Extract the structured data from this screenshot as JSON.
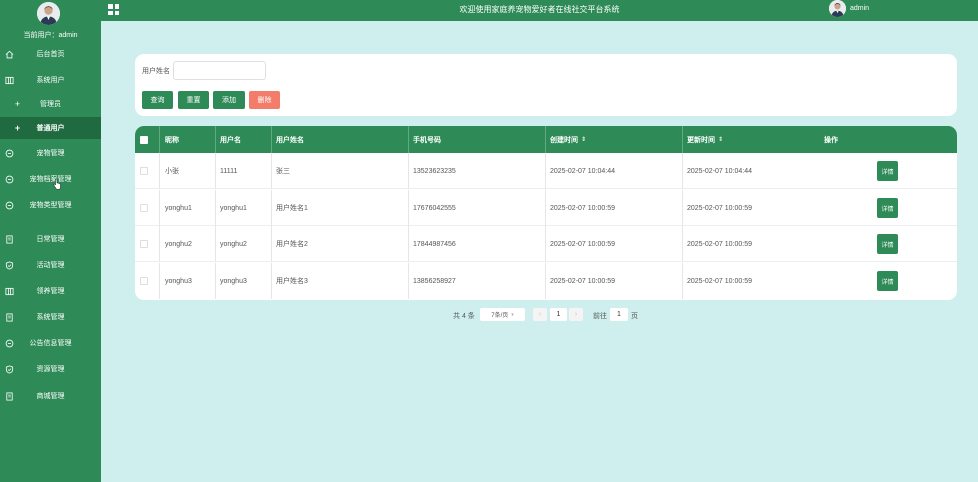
{
  "sidebar": {
    "current_user": "当前用户：admin",
    "items": [
      {
        "label": "后台首页",
        "icon": "home-icon"
      },
      {
        "label": "系统用户",
        "icon": "columns-icon"
      },
      {
        "label": "管理员",
        "icon": "plus-icon"
      },
      {
        "label": "普通用户",
        "icon": "plus-icon"
      },
      {
        "label": "宠物管理",
        "icon": "chat-icon"
      },
      {
        "label": "宠物档案管理",
        "icon": "chat-icon"
      },
      {
        "label": "宠物类型管理",
        "icon": "chat-icon"
      },
      {
        "label": "日常管理",
        "icon": "document-icon"
      },
      {
        "label": "活动管理",
        "icon": "shield-icon"
      },
      {
        "label": "领养管理",
        "icon": "columns-icon"
      },
      {
        "label": "系统管理",
        "icon": "document-icon"
      },
      {
        "label": "公告信息管理",
        "icon": "chat-icon"
      },
      {
        "label": "资源管理",
        "icon": "shield-icon"
      },
      {
        "label": "商城管理",
        "icon": "document-icon"
      }
    ]
  },
  "topbar": {
    "title": "欢迎使用家庭养宠物爱好者在线社交平台系统",
    "username": "admin"
  },
  "search": {
    "label": "用户姓名",
    "value": "",
    "buttons": {
      "query": "查询",
      "reset": "重置",
      "add": "添加",
      "delete": "删除"
    }
  },
  "table": {
    "headers": [
      "昵称",
      "用户名",
      "用户姓名",
      "手机号码",
      "创建时间",
      "更新时间",
      "操作"
    ],
    "rows": [
      {
        "nickname": "小张",
        "username": "11111",
        "realname": "张三",
        "phone": "13523623235",
        "created": "2025-02-07 10:04:44",
        "updated": "2025-02-07 10:04:44",
        "action": "详情"
      },
      {
        "nickname": "yonghu1",
        "username": "yonghu1",
        "realname": "用户姓名1",
        "phone": "17676042555",
        "created": "2025-02-07 10:00:59",
        "updated": "2025-02-07 10:00:59",
        "action": "详情"
      },
      {
        "nickname": "yonghu2",
        "username": "yonghu2",
        "realname": "用户姓名2",
        "phone": "17844987456",
        "created": "2025-02-07 10:00:59",
        "updated": "2025-02-07 10:00:59",
        "action": "详情"
      },
      {
        "nickname": "yonghu3",
        "username": "yonghu3",
        "realname": "用户姓名3",
        "phone": "13856258927",
        "created": "2025-02-07 10:00:59",
        "updated": "2025-02-07 10:00:59",
        "action": "详情"
      }
    ]
  },
  "pagination": {
    "total": "共 4 条",
    "page_size": "7条/页",
    "prev": "‹",
    "next": "›",
    "current_page": "1",
    "goto_label": "前往",
    "goto_value": "1",
    "goto_unit": "页"
  },
  "colors": {
    "primary": "#2e8b57",
    "danger": "#f47c6b",
    "background": "#cfefef"
  }
}
